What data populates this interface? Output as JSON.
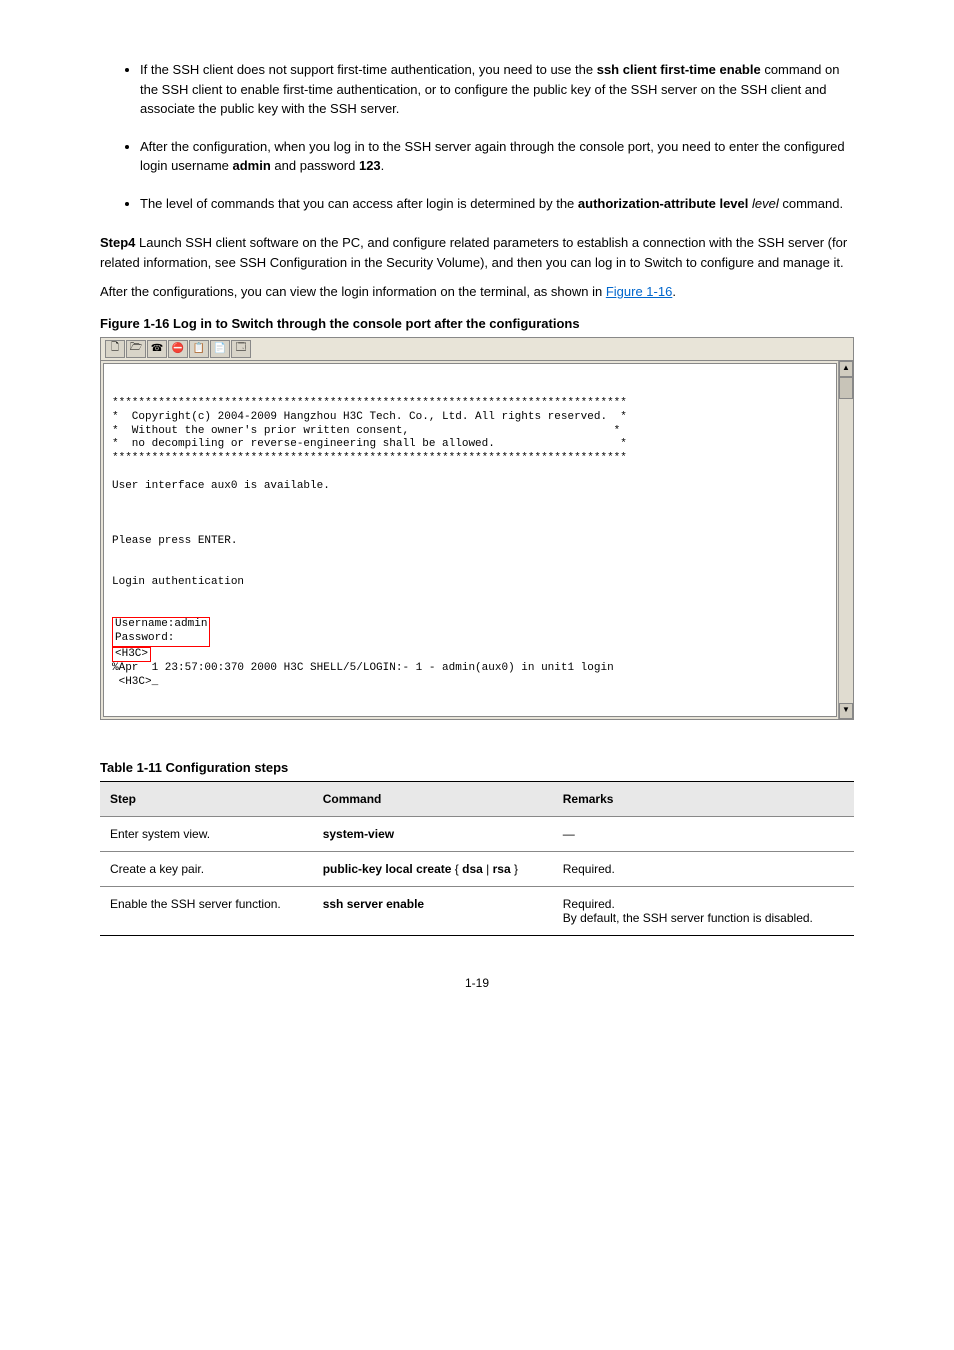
{
  "bullets": [
    {
      "text": "If the SSH client does not support first-time authentication, you need to use the ",
      "cmd": "ssh client first-time enable",
      "text2": " command on the SSH client to enable first-time authentication, or to configure the public key of the SSH server on the SSH client and associate the public key with the SSH server."
    },
    {
      "text": "After the configuration, when you log in to the SSH server again through the console port, you need to enter the configured login username ",
      "cmd": "admin",
      "text2": " and password ",
      "cmd2": "123",
      "text3": "."
    },
    {
      "text": "The level of commands that you can access after login is determined by the ",
      "cmd": "authorization-attribute level",
      "text2": " ",
      "arg": "level",
      "text3": " command."
    }
  ],
  "step": "Step4",
  "step_text": " Launch SSH client software on the PC, and configure related parameters to establish a connection with the SSH server (for related information, see SSH Configuration in the Security Volume), and then you can log in to Switch to configure and manage it.",
  "figref_pre": "After the configurations, you can view the login information on the terminal, as shown in ",
  "figref": "Figure 1-16",
  "figref_post": ".",
  "fig_caption": "Figure 1-16 Log in to Switch through the console port after the configurations",
  "terminal_lines": [
    "",
    "",
    "******************************************************************************",
    "*  Copyright(c) 2004-2009 Hangzhou H3C Tech. Co., Ltd. All rights reserved.  *",
    "*  Without the owner's prior written consent,                               *",
    "*  no decompiling or reverse-engineering shall be allowed.                   *",
    "******************************************************************************",
    "",
    "User interface aux0 is available.",
    "",
    "",
    "",
    "Please press ENTER.",
    "",
    "",
    "Login authentication",
    "",
    ""
  ],
  "terminal_red1": "Username:admin\nPassword:",
  "terminal_red2": "<H3C>",
  "terminal_tail": "%Apr  1 23:57:00:370 2000 H3C SHELL/5/LOGIN:- 1 - admin(aux0) in unit1 login\n <H3C>_",
  "table_caption": "Table 1-11 Configuration steps",
  "table": {
    "headers": [
      "Step",
      "Command",
      "Remarks"
    ],
    "rows": [
      [
        "Enter system view.",
        "system-view",
        "—"
      ],
      [
        "Create a key pair.",
        {
          "b1": "public-key local create",
          "r": " { ",
          "b2": "dsa",
          "r2": " | ",
          "b3": "rsa",
          "r3": " }"
        },
        "Required."
      ],
      [
        "Enable the SSH server function.",
        "ssh server enable",
        "Required.\nBy default, the SSH server function is disabled."
      ]
    ]
  },
  "page_number": "1-19"
}
